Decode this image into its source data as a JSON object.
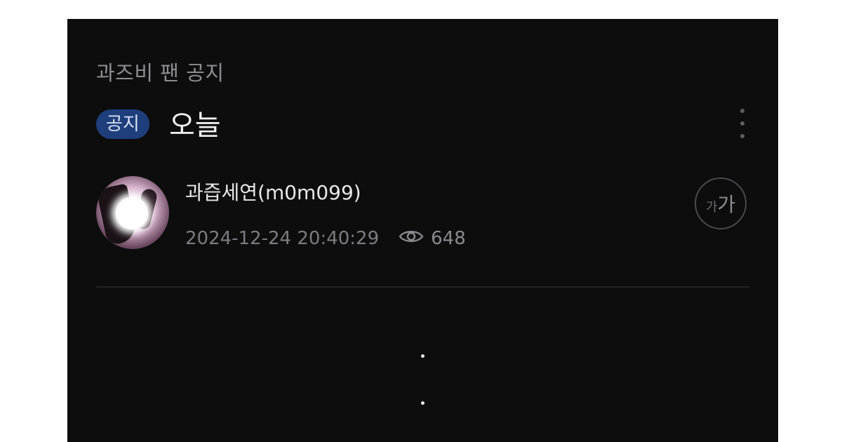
{
  "board": {
    "name": "과즈비 팬 공지"
  },
  "post": {
    "badge": "공지",
    "title": "오늘",
    "author": "과즙세연(m0m099)",
    "datetime": "2024-12-24 20:40:29",
    "views": "648",
    "body_lines": [
      ".",
      "."
    ]
  },
  "controls": {
    "font_size_small": "가",
    "font_size_large": "가",
    "more_icon": "more-vertical-icon",
    "view_icon": "eye-icon"
  },
  "colors": {
    "background": "#0d0d0e",
    "badge_bg": "#1f3f7c",
    "text_primary": "#f2f2f2",
    "text_secondary": "#7c7c80"
  }
}
